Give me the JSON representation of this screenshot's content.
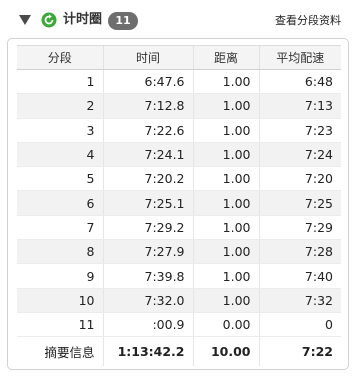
{
  "header": {
    "title": "计时圈",
    "count": "11",
    "detail_link": "查看分段资料"
  },
  "table": {
    "columns": [
      "分段",
      "时间",
      "距离",
      "平均配速"
    ],
    "rows": [
      [
        "1",
        "6:47.6",
        "1.00",
        "6:48"
      ],
      [
        "2",
        "7:12.8",
        "1.00",
        "7:13"
      ],
      [
        "3",
        "7:22.6",
        "1.00",
        "7:23"
      ],
      [
        "4",
        "7:24.1",
        "1.00",
        "7:24"
      ],
      [
        "5",
        "7:20.2",
        "1.00",
        "7:20"
      ],
      [
        "6",
        "7:25.1",
        "1.00",
        "7:25"
      ],
      [
        "7",
        "7:29.2",
        "1.00",
        "7:29"
      ],
      [
        "8",
        "7:27.9",
        "1.00",
        "7:28"
      ],
      [
        "9",
        "7:39.8",
        "1.00",
        "7:40"
      ],
      [
        "10",
        "7:32.0",
        "1.00",
        "7:32"
      ],
      [
        "11",
        ":00.9",
        "0.00",
        "0"
      ]
    ],
    "summary": [
      "摘要信息",
      "1:13:42.2",
      "10.00",
      "7:22"
    ]
  },
  "colors": {
    "accent_green": "#3aa935",
    "badge_gray": "#6e6e6e",
    "row_alt": "#f2f2f2"
  },
  "icons": [
    "collapse-triangle-icon",
    "refresh-icon"
  ]
}
